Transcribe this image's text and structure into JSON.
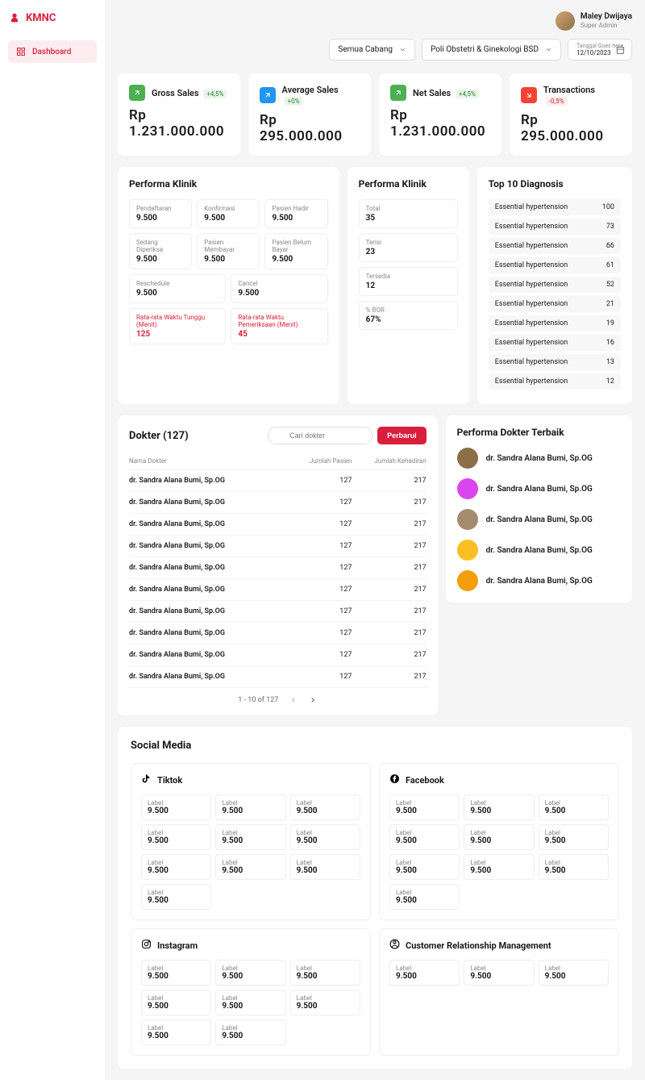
{
  "brand": "KMNC",
  "nav": {
    "dashboard": "Dashboard"
  },
  "user": {
    "name": "Maley Dwijaya",
    "role": "Super Admin"
  },
  "filters": {
    "branch": "Semua Cabang",
    "clinic": "Poli Obstetri & Ginekologi BSD",
    "date_label": "Tanggal Goes here",
    "date_value": "12/10/2023"
  },
  "kpis": [
    {
      "title": "Gross Sales",
      "delta": "+4,5%",
      "delta_class": "pos",
      "value": "Rp 1.231.000.000",
      "icon_class": "green"
    },
    {
      "title": "Average Sales",
      "delta": "+0%",
      "delta_class": "pos",
      "value": "Rp 295.000.000",
      "icon_class": "blue"
    },
    {
      "title": "Net Sales",
      "delta": "+4,5%",
      "delta_class": "pos",
      "value": "Rp 1.231.000.000",
      "icon_class": "green"
    },
    {
      "title": "Transactions",
      "delta": "-0,5%",
      "delta_class": "neg",
      "value": "Rp 295.000.000",
      "icon_class": "red"
    }
  ],
  "performa1": {
    "title": "Performa Klinik",
    "row1": [
      {
        "label": "Pendaftaran",
        "value": "9.500"
      },
      {
        "label": "Konfirmasi",
        "value": "9.500"
      },
      {
        "label": "Pasien Hadir",
        "value": "9.500"
      }
    ],
    "row2": [
      {
        "label": "Sedang Diperiksa",
        "value": "9.500"
      },
      {
        "label": "Pasien Membayar",
        "value": "9.500"
      },
      {
        "label": "Pasien Belum Bayar",
        "value": "9.500"
      }
    ],
    "row3": [
      {
        "label": "Reschedule",
        "value": "9.500"
      },
      {
        "label": "Cancel",
        "value": "9.500"
      }
    ],
    "row4": [
      {
        "label": "Rata-rata Waktu Tunggu (Menit)",
        "value": "125"
      },
      {
        "label": "Rata-rata Waktu Pemeriksaan (Menit)",
        "value": "45"
      }
    ]
  },
  "performa2": {
    "title": "Performa Klinik",
    "stats": [
      {
        "label": "Total",
        "value": "35"
      },
      {
        "label": "Terisi",
        "value": "23"
      },
      {
        "label": "Tersedia",
        "value": "12"
      },
      {
        "label": "% BOR",
        "value": "67%"
      }
    ]
  },
  "diagnosis": {
    "title": "Top 10 Diagnosis",
    "items": [
      {
        "name": "Essential hypertension",
        "count": "100"
      },
      {
        "name": "Essential hypertension",
        "count": "73"
      },
      {
        "name": "Essential hypertension",
        "count": "66"
      },
      {
        "name": "Essential hypertension",
        "count": "61"
      },
      {
        "name": "Essential hypertension",
        "count": "52"
      },
      {
        "name": "Essential hypertension",
        "count": "21"
      },
      {
        "name": "Essential hypertension",
        "count": "19"
      },
      {
        "name": "Essential hypertension",
        "count": "16"
      },
      {
        "name": "Essential hypertension",
        "count": "13"
      },
      {
        "name": "Essential hypertension",
        "count": "12"
      }
    ]
  },
  "dokter": {
    "title": "Dokter (127)",
    "search_placeholder": "Cari dokter",
    "btn": "Perbarui",
    "th": {
      "name": "Nama Dokter",
      "pasien": "Jumlah Pasien",
      "hadir": "Jumlah Kehadiran"
    },
    "rows": [
      {
        "name": "dr. Sandra Alana Bumi, Sp.OG",
        "p": "127",
        "h": "217"
      },
      {
        "name": "dr. Sandra Alana Bumi, Sp.OG",
        "p": "127",
        "h": "217"
      },
      {
        "name": "dr. Sandra Alana Bumi, Sp.OG",
        "p": "127",
        "h": "217"
      },
      {
        "name": "dr. Sandra Alana Bumi, Sp.OG",
        "p": "127",
        "h": "217"
      },
      {
        "name": "dr. Sandra Alana Bumi, Sp.OG",
        "p": "127",
        "h": "217"
      },
      {
        "name": "dr. Sandra Alana Bumi, Sp.OG",
        "p": "127",
        "h": "217"
      },
      {
        "name": "dr. Sandra Alana Bumi, Sp.OG",
        "p": "127",
        "h": "217"
      },
      {
        "name": "dr. Sandra Alana Bumi, Sp.OG",
        "p": "127",
        "h": "217"
      },
      {
        "name": "dr. Sandra Alana Bumi, Sp.OG",
        "p": "127",
        "h": "217"
      },
      {
        "name": "dr. Sandra Alana Bumi, Sp.OG",
        "p": "127",
        "h": "217"
      }
    ],
    "pager": "1 - 10  of  127"
  },
  "top_dokter": {
    "title": "Performa Dokter Terbaik",
    "drs": [
      {
        "name": "dr. Sandra Alana Bumi, Sp.OG",
        "color": "#8b6f47"
      },
      {
        "name": "dr. Sandra Alana Bumi, Sp.OG",
        "color": "#d946ef"
      },
      {
        "name": "dr. Sandra Alana Bumi, Sp.OG",
        "color": "#a78b6f"
      },
      {
        "name": "dr. Sandra Alana Bumi, Sp.OG",
        "color": "#fbbf24"
      },
      {
        "name": "dr. Sandra Alana Bumi, Sp.OG",
        "color": "#f59e0b"
      }
    ]
  },
  "social": {
    "title": "Social Media",
    "sections": [
      {
        "name": "Tiktok",
        "icon": "tiktok",
        "metrics": [
          {
            "l": "Label",
            "v": "9.500"
          },
          {
            "l": "Label",
            "v": "9.500"
          },
          {
            "l": "Label",
            "v": "9.500"
          },
          {
            "l": "Label",
            "v": "9.500"
          },
          {
            "l": "Label",
            "v": "9.500"
          },
          {
            "l": "Label",
            "v": "9.500"
          },
          {
            "l": "Label",
            "v": "9.500"
          },
          {
            "l": "Label",
            "v": "9.500"
          },
          {
            "l": "Label",
            "v": "9.500"
          },
          {
            "l": "Label",
            "v": "9.500"
          }
        ]
      },
      {
        "name": "Facebook",
        "icon": "facebook",
        "metrics": [
          {
            "l": "Label",
            "v": "9.500"
          },
          {
            "l": "Label",
            "v": "9.500"
          },
          {
            "l": "Label",
            "v": "9.500"
          },
          {
            "l": "Label",
            "v": "9.500"
          },
          {
            "l": "Label",
            "v": "9.500"
          },
          {
            "l": "Label",
            "v": "9.500"
          },
          {
            "l": "Label",
            "v": "9.500"
          },
          {
            "l": "Label",
            "v": "9.500"
          },
          {
            "l": "Label",
            "v": "9.500"
          },
          {
            "l": "Label",
            "v": "9.500"
          }
        ]
      },
      {
        "name": "Instagram",
        "icon": "instagram",
        "metrics": [
          {
            "l": "Label",
            "v": "9.500"
          },
          {
            "l": "Label",
            "v": "9.500"
          },
          {
            "l": "Label",
            "v": "9.500"
          },
          {
            "l": "Label",
            "v": "9.500"
          },
          {
            "l": "Label",
            "v": "9.500"
          },
          {
            "l": "Label",
            "v": "9.500"
          },
          {
            "l": "Label",
            "v": "9.500"
          },
          {
            "l": "Label",
            "v": "9.500"
          }
        ]
      },
      {
        "name": "Customer Relationship Management",
        "icon": "crm",
        "metrics": [
          {
            "l": "Label",
            "v": "9.500"
          },
          {
            "l": "Label",
            "v": "9.500"
          },
          {
            "l": "Label",
            "v": "9.500"
          }
        ]
      }
    ]
  }
}
